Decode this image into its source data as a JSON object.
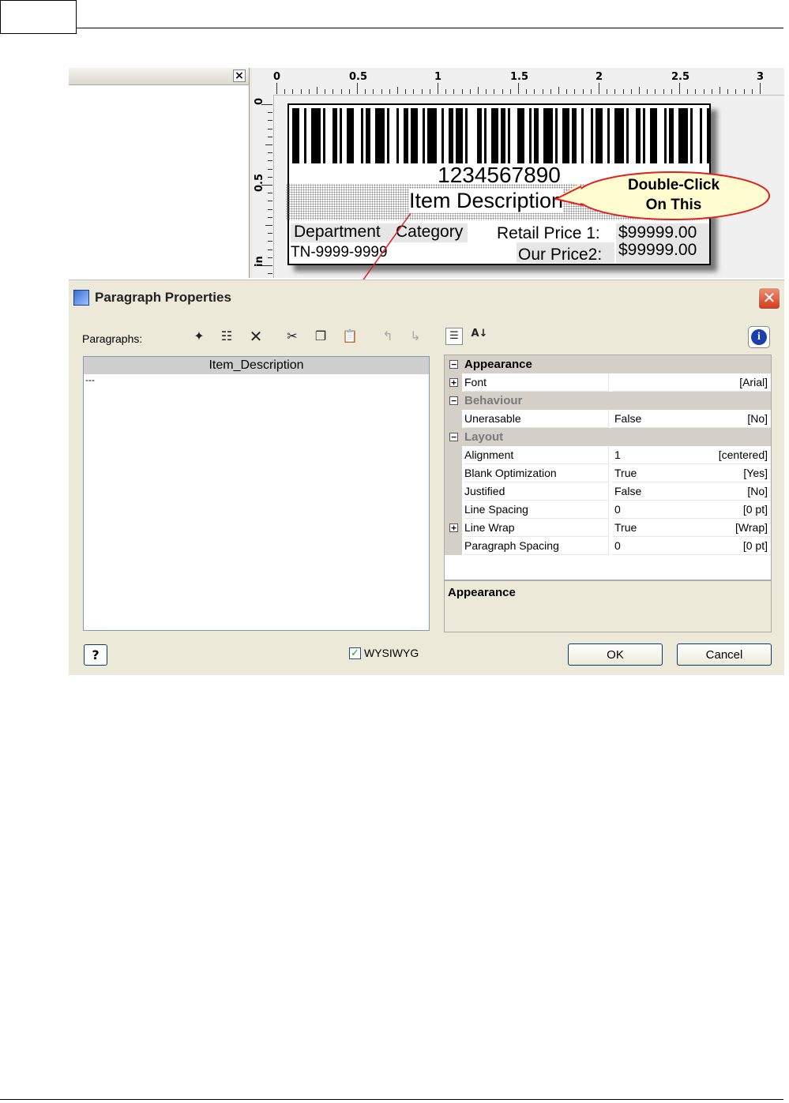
{
  "designer": {
    "ruler_h": [
      "0",
      "0.5",
      "1",
      "1.5",
      "2",
      "2.5",
      "3"
    ],
    "ruler_v": [
      "0",
      "0.5",
      "in"
    ],
    "label": {
      "barcode_number": "1234567890",
      "item_description": "Item Description",
      "department": "Department",
      "category": "Category",
      "retail_price_label": "Retail Price 1:",
      "retail_price_value": "$99999.00",
      "sku": "TN-9999-9999",
      "our_price_label": "Our Price2:",
      "our_price_value": "$99999.00"
    },
    "callout": {
      "line1": "Double-Click",
      "line2": "On This"
    }
  },
  "dialog": {
    "title": "Paragraph Properties",
    "paragraphs_label": "Paragraphs:",
    "toolbar_icons": [
      "new-paragraph-icon",
      "properties-icon",
      "delete-icon",
      "cut-icon",
      "copy-icon",
      "paste-icon",
      "move-up-icon",
      "move-down-icon"
    ],
    "list_header": "Item_Description",
    "list_items": [
      "---"
    ],
    "grid": {
      "categories": [
        {
          "name": "Appearance",
          "muted": false,
          "rows": [
            {
              "name": "Font",
              "value": "",
              "display": "[Arial]",
              "expandable": true
            }
          ]
        },
        {
          "name": "Behaviour",
          "muted": true,
          "rows": [
            {
              "name": "Unerasable",
              "value": "False",
              "display": "[No]",
              "expandable": false
            }
          ]
        },
        {
          "name": "Layout",
          "muted": true,
          "rows": [
            {
              "name": "Alignment",
              "value": "1",
              "display": "[centered]",
              "expandable": false
            },
            {
              "name": "Blank Optimization",
              "value": "True",
              "display": "[Yes]",
              "expandable": false
            },
            {
              "name": "Justified",
              "value": "False",
              "display": "[No]",
              "expandable": false
            },
            {
              "name": "Line Spacing",
              "value": "0",
              "display": "[0 pt]",
              "expandable": false
            },
            {
              "name": "Line Wrap",
              "value": "True",
              "display": "[Wrap]",
              "expandable": true
            },
            {
              "name": "Paragraph Spacing",
              "value": "0",
              "display": "[0 pt]",
              "expandable": false
            }
          ]
        }
      ],
      "description_title": "Appearance"
    },
    "wysiwyg_label": "WYSIWYG",
    "wysiwyg_checked": true,
    "ok_label": "OK",
    "cancel_label": "Cancel"
  },
  "colors": {
    "accent_arrow": "#e02020",
    "callout_fill": "#fffdd0",
    "callout_border": "#e02020"
  }
}
